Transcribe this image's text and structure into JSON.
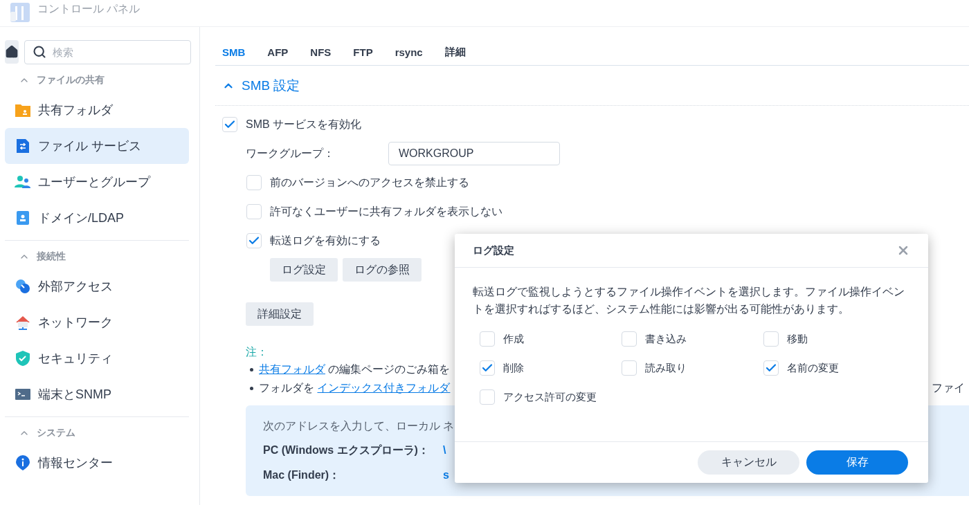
{
  "window": {
    "title": "コントロール パネル"
  },
  "search": {
    "placeholder": "検索"
  },
  "sidebar": {
    "groups": [
      {
        "label": "ファイルの共有",
        "expanded": true,
        "items": [
          {
            "label": "共有フォルダ",
            "selected": false
          },
          {
            "label": "ファイル サービス",
            "selected": true
          },
          {
            "label": "ユーザーとグループ",
            "selected": false
          },
          {
            "label": "ドメイン/LDAP",
            "selected": false
          }
        ]
      },
      {
        "label": "接続性",
        "expanded": true,
        "items": [
          {
            "label": "外部アクセス",
            "selected": false
          },
          {
            "label": "ネットワーク",
            "selected": false
          },
          {
            "label": "セキュリティ",
            "selected": false
          },
          {
            "label": "端末とSNMP",
            "selected": false
          }
        ]
      },
      {
        "label": "システム",
        "expanded": true,
        "items": [
          {
            "label": "情報センター",
            "selected": false
          }
        ]
      }
    ]
  },
  "tabs": [
    {
      "label": "SMB",
      "selected": true
    },
    {
      "label": "AFP",
      "selected": false
    },
    {
      "label": "NFS",
      "selected": false
    },
    {
      "label": "FTP",
      "selected": false
    },
    {
      "label": "rsync",
      "selected": false
    },
    {
      "label": "詳細",
      "selected": false
    }
  ],
  "section": {
    "title": "SMB 設定",
    "expanded": true,
    "enable": {
      "label": "SMB サービスを有効化",
      "checked": true
    },
    "workgroup": {
      "label": "ワークグループ：",
      "value": "WORKGROUP"
    },
    "options": [
      {
        "label": "前のバージョンへのアクセスを禁止する",
        "checked": false
      },
      {
        "label": "許可なくユーザーに共有フォルダを表示しない",
        "checked": false
      },
      {
        "label": "転送ログを有効にする",
        "checked": true
      }
    ],
    "log_buttons": [
      "ログ設定",
      "ログの参照"
    ],
    "advanced_button": "詳細設定"
  },
  "note": {
    "title": "注：",
    "bullets": [
      {
        "link": "共有フォルダ",
        "after": " の編集ページのごみ箱を"
      },
      {
        "before": "フォルダを ",
        "link": "インデックス付きフォルダ",
        "tail": "ファイ"
      }
    ]
  },
  "address_box": {
    "intro": "次のアドレスを入力して、ローカル ネ",
    "rows": [
      {
        "label": "PC (Windows エクスプローラ)：",
        "value": "\\"
      },
      {
        "label": "Mac (Finder)：",
        "value": "s"
      }
    ]
  },
  "dialog": {
    "title": "ログ設定",
    "description": "転送ログで監視しようとするファイル操作イベントを選択します。ファイル操作イベントを選択すればするほど、システム性能には影響が出る可能性があります。",
    "options": [
      {
        "label": "作成",
        "checked": false
      },
      {
        "label": "書き込み",
        "checked": false
      },
      {
        "label": "移動",
        "checked": false
      },
      {
        "label": "削除",
        "checked": true
      },
      {
        "label": "読み取り",
        "checked": false
      },
      {
        "label": "名前の変更",
        "checked": true
      },
      {
        "label": "アクセス許可の変更",
        "checked": false
      }
    ],
    "buttons": [
      {
        "label": "キャンセル",
        "kind": "secondary"
      },
      {
        "label": "保存",
        "kind": "primary"
      }
    ]
  }
}
